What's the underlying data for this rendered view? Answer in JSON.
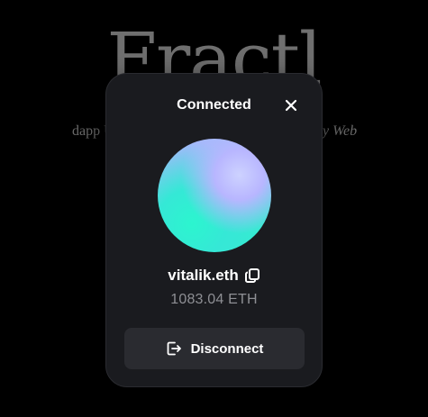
{
  "background": {
    "title": "Fractl",
    "subtitle_visible_start": "dapp U",
    "subtitle_visible_end": "y Web"
  },
  "modal": {
    "title": "Connected",
    "close_icon": "close-icon",
    "account_name": "vitalik.eth",
    "copy_icon": "copy-icon",
    "balance": "1083.04 ETH",
    "disconnect_label": "Disconnect",
    "disconnect_icon": "logout-icon"
  },
  "colors": {
    "page_background": "#000000",
    "modal_background": "#1a1b1f",
    "button_background": "#2a2b30",
    "balance_text": "#8e8f94",
    "avatar_gradient": [
      "#b4b0ff",
      "#42e6d8",
      "#26f2c6"
    ]
  }
}
